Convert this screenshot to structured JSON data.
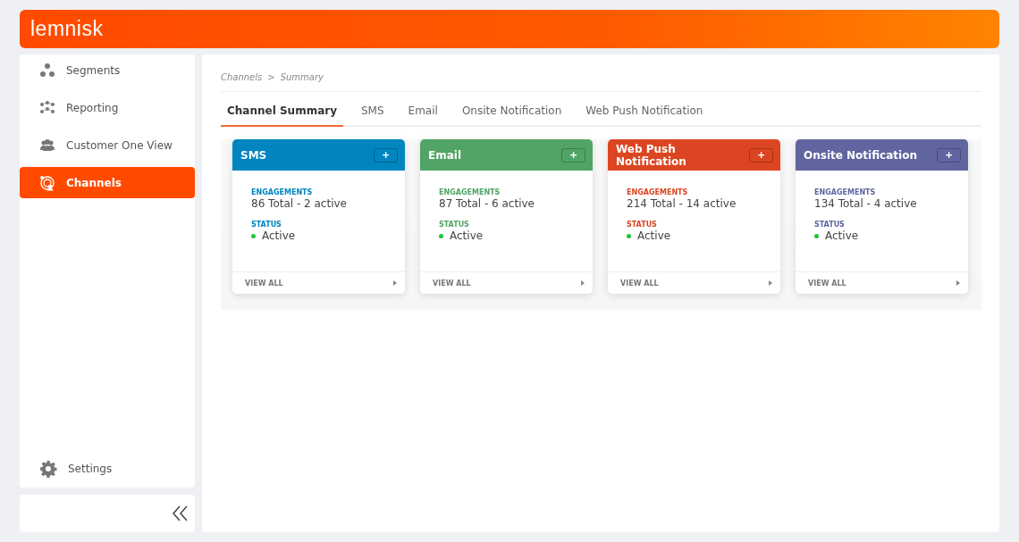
{
  "header": {
    "logo": "lemnisk"
  },
  "sidebar": {
    "items": [
      {
        "label": "Segments",
        "selected": false
      },
      {
        "label": "Reporting",
        "selected": false
      },
      {
        "label": "Customer One View",
        "selected": false
      },
      {
        "label": "Channels",
        "selected": true
      }
    ],
    "settings": "Settings"
  },
  "breadcrumb": [
    "Channels",
    ">",
    "Summary"
  ],
  "tabs": [
    {
      "label": "Channel Summary",
      "selected": true
    },
    {
      "label": "SMS",
      "selected": false
    },
    {
      "label": "Email",
      "selected": false
    },
    {
      "label": "Onsite Notification",
      "selected": false
    },
    {
      "label": "Web Push Notification",
      "selected": false
    }
  ],
  "cards": [
    {
      "title": "SMS",
      "color": "#0085bf",
      "add": "+",
      "engagements_label": "ENGAGEMENTS",
      "engagements": "86 Total - 2 active",
      "status_label": "STATUS",
      "status": "Active",
      "footer": "VIEW ALL"
    },
    {
      "title": "Email",
      "color": "#52a466",
      "add": "+",
      "engagements_label": "ENGAGEMENTS",
      "engagements": "87 Total - 6 active",
      "status_label": "STATUS",
      "status": "Active",
      "footer": "VIEW ALL"
    },
    {
      "title": "Web Push Notification",
      "color": "#dc4521",
      "add": "+",
      "engagements_label": "ENGAGEMENTS",
      "engagements": "214 Total - 14 active",
      "status_label": "STATUS",
      "status": "Active",
      "footer": "VIEW ALL"
    },
    {
      "title": "Onsite Notification",
      "color": "#60659f",
      "add": "+",
      "engagements_label": "ENGAGEMENTS",
      "engagements": "134 Total - 4 active",
      "status_label": "STATUS",
      "status": "Active",
      "footer": "VIEW ALL"
    }
  ]
}
